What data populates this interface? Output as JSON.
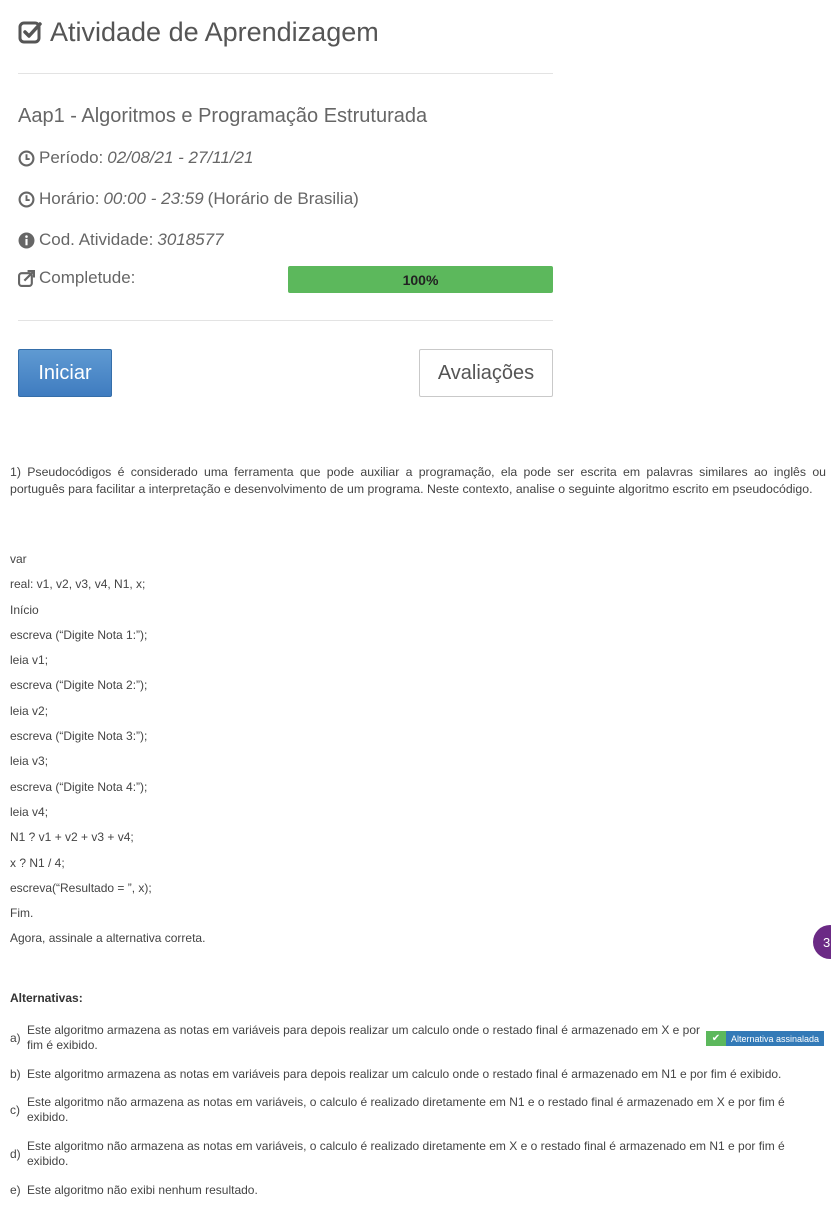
{
  "header": {
    "title": "Atividade de Aprendizagem"
  },
  "activity": {
    "name": "Aap1 - Algoritmos e Programação Estruturada",
    "period_label": "Período:",
    "period_value": "02/08/21 - 27/11/21",
    "time_label": "Horário:",
    "time_value": "00:00 - 23:59",
    "time_suffix": "(Horário de Brasilia)",
    "code_label": "Cod. Atividade:",
    "code_value": "3018577",
    "completeness_label": "Completude:",
    "completeness_text": "100%",
    "completeness_fraction": 1.0
  },
  "buttons": {
    "start": "Iniciar",
    "evaluations": "Avaliações"
  },
  "question": {
    "text": "1) Pseudocódigos é considerado uma ferramenta que pode auxiliar a programação, ela pode ser escrita em palavras similares ao inglês ou português para facilitar a interpretação e desenvolvimento de um programa. Neste contexto, analise o seguinte algoritmo escrito em pseudocódigo.",
    "code_lines": [
      "var",
      "real: v1, v2, v3, v4, N1, x;",
      "Início",
      "escreva (“Digite Nota 1:”);",
      "leia v1;",
      "escreva (“Digite Nota 2:”);",
      "leia v2;",
      "escreva (“Digite Nota 3:”);",
      "leia v3;",
      "escreva (“Digite Nota 4:”);",
      "leia v4;",
      "N1 ? v1 + v2 + v3 + v4;",
      "x ? N1 / 4;",
      "escreva(“Resultado = ”, x);",
      "Fim.",
      "Agora, assinale a alternativa correta."
    ]
  },
  "fab": {
    "label": "3"
  },
  "alternatives": {
    "title": "Alternativas:",
    "selected_badge": "Alternativa assinalada",
    "items": [
      {
        "letter": "a)",
        "text": "Este algoritmo armazena as notas em variáveis para depois realizar um calculo onde o restado final é armazenado em X e por fim é exibido."
      },
      {
        "letter": "b)",
        "text": "Este algoritmo armazena as notas em variáveis para depois realizar um calculo onde o restado final é armazenado em N1 e por fim é exibido."
      },
      {
        "letter": "c)",
        "text": "Este algoritmo não armazena as notas em variáveis, o calculo é realizado diretamente em N1 e o restado final é armazenado em X e por fim é exibido."
      },
      {
        "letter": "d)",
        "text": "Este algoritmo não armazena as notas em variáveis, o calculo é realizado diretamente em X e o restado final é armazenado em N1 e por fim é exibido."
      },
      {
        "letter": "e)",
        "text": "Este algoritmo não exibi nenhum resultado."
      }
    ]
  },
  "colors": {
    "progress": "#5cb85c",
    "primary": "#337ab7",
    "fab": "#6b2a85"
  }
}
